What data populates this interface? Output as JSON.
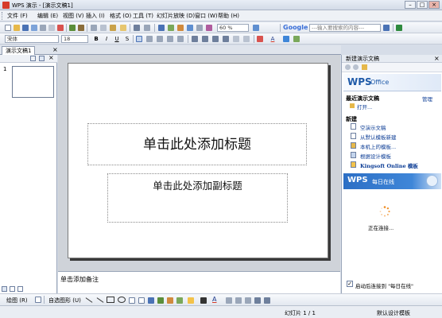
{
  "window": {
    "title": "WPS 演示 - [演示文稿1]",
    "min_glyph": "–",
    "max_glyph": "□",
    "close_glyph": "×"
  },
  "menu": [
    {
      "label": "文件 (F)"
    },
    {
      "label": "编辑 (E)"
    },
    {
      "label": "视图 (V)"
    },
    {
      "label": "插入 (I)"
    },
    {
      "label": "格式 (O)"
    },
    {
      "label": "工具 (T)"
    },
    {
      "label": "幻灯片放映 (D)"
    },
    {
      "label": "窗口 (W)"
    },
    {
      "label": "帮助 (H)"
    }
  ],
  "standard_toolbar": {
    "zoom": "60 %",
    "google_label": "Google",
    "search_placeholder": "---输入要搜索的内容---"
  },
  "format_toolbar": {
    "font": "宋体",
    "size": "18",
    "bold": "B",
    "italic": "I",
    "underline": "U",
    "shadow": "S",
    "font_color": "A"
  },
  "tabs": {
    "doc_tab": "演示文稿1",
    "close_glyph": "×"
  },
  "slides_pane": {
    "thumb_number": "1"
  },
  "slide": {
    "title_placeholder": "单击此处添加标题",
    "subtitle_placeholder": "单击此处添加副标题"
  },
  "notes": {
    "placeholder": "单击添加备注"
  },
  "task_pane": {
    "title": "新建演示文稿",
    "logo_wps": "WPS",
    "logo_office": "Office",
    "recent_heading": "最近演示文稿",
    "manage_link": "管理",
    "open_link": "打开...",
    "new_heading": "新建",
    "new_items": [
      {
        "label": "空演示文稿"
      },
      {
        "label": "从默认模板新建"
      },
      {
        "label": "本机上的模板..."
      },
      {
        "label": "根据设计模板"
      },
      {
        "label": "Kingsoft Online 模板"
      }
    ],
    "daily_wps": "WPS",
    "daily_label": "每日在线",
    "connecting": "正在连接...",
    "startup_label": "启动后连接到 \"每日在线\"",
    "startup_checked": true
  },
  "draw_toolbar": {
    "draw_label": "绘图 (R)",
    "autoshape_label": "自选图形 (U)"
  },
  "status": {
    "slide_info": "幻灯片 1 / 1",
    "design": "默认设计模板"
  },
  "colors": {
    "accent": "#1f5aa8",
    "link": "#0b3c95",
    "app_red": "#d63b2a"
  }
}
